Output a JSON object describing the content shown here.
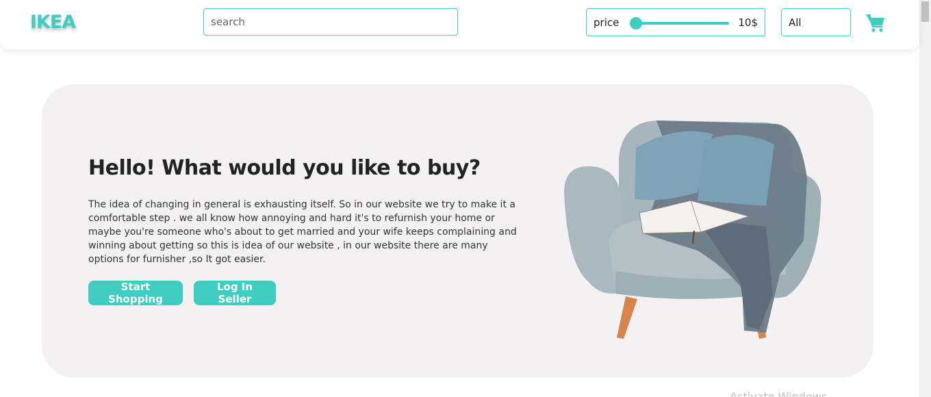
{
  "header": {
    "logo": "IKEA",
    "search": {
      "placeholder": "search",
      "value": ""
    },
    "price_filter": {
      "label": "price",
      "value": "10$",
      "level": 0.0
    },
    "category": {
      "selected": "All"
    },
    "cart_icon": "cart-icon"
  },
  "hero": {
    "title": "Hello! What would you like to buy?",
    "description": "The idea of changing in general is exhausting itself. So in our website we try to make it a comfortable step . we all know how annoying and hard it's to refurnish your home or maybe you're someone who's about to get married and your wife keeps complaining and winning about getting so this is idea of our website , in our website there are many options for furnisher ,so It got easier.",
    "buttons": {
      "start_shopping": "Start Shopping",
      "log_in_seller": "Log In Seller"
    },
    "image": "armchair-with-pillows-blanket-and-book"
  },
  "watermark": "Activate Windows",
  "colors": {
    "accent": "#3ecdc0",
    "hero_background": "#f3f1f2",
    "text_dark": "#222222"
  }
}
